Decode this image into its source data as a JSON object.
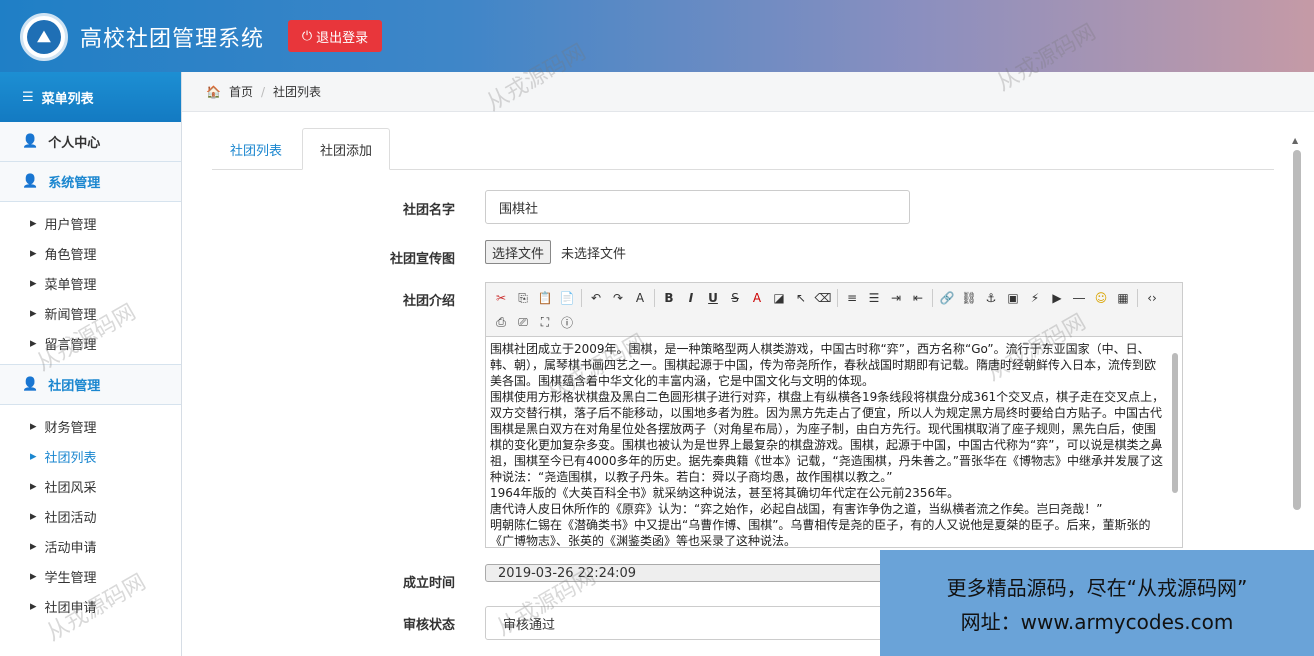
{
  "header": {
    "title": "高校社团管理系统",
    "logout_label": "退出登录"
  },
  "sidebar": {
    "menu_title": "菜单列表",
    "personal": "个人中心",
    "system": {
      "label": "系统管理",
      "items": [
        "用户管理",
        "角色管理",
        "菜单管理",
        "新闻管理",
        "留言管理"
      ]
    },
    "club": {
      "label": "社团管理",
      "items": [
        "财务管理",
        "社团列表",
        "社团风采",
        "社团活动",
        "活动申请",
        "学生管理",
        "社团申请"
      ]
    },
    "active_item": "社团列表"
  },
  "breadcrumb": {
    "home": "首页",
    "current": "社团列表"
  },
  "tabs": [
    {
      "label": "社团列表"
    },
    {
      "label": "社团添加"
    }
  ],
  "form": {
    "name_label": "社团名字",
    "name_value": "围棋社",
    "image_label": "社团宣传图",
    "file_button": "选择文件",
    "file_status": "未选择文件",
    "intro_label": "社团介绍",
    "intro_paragraphs": [
      "围棋社团成立于2009年。围棋，是一种策略型两人棋类游戏，中国古时称“弈”，西方名称“Go”。流行于东亚国家（中、日、韩、朝），属琴棋书画四艺之一。围棋起源于中国，传为帝尧所作，春秋战国时期即有记载。隋唐时经朝鲜传入日本，流传到欧美各国。围棋蕴含着中华文化的丰富内涵，它是中国文化与文明的体现。",
      "围棋使用方形格状棋盘及黑白二色圆形棋子进行对弈，棋盘上有纵横各19条线段将棋盘分成361个交叉点，棋子走在交叉点上，双方交替行棋，落子后不能移动，以围地多者为胜。因为黑方先走占了便宜，所以人为规定黑方局终时要给白方贴子。中国古代围棋是黑白双方在对角星位处各摆放两子（对角星布局），为座子制，由白方先行。现代围棋取消了座子规则，黑先白后，使围棋的变化更加复杂多变。围棋也被认为是世界上最复杂的棋盘游戏。围棋，起源于中国，中国古代称为“弈”，可以说是棋类之鼻祖，围棋至今已有4000多年的历史。据先秦典籍《世本》记载，“尧造围棋，丹朱善之。”晋张华在《博物志》中继承并发展了这种说法：“尧造围棋，以教子丹朱。若白：舜以子商均愚，故作围棋以教之。”",
      "1964年版的《大英百科全书》就采纳这种说法，甚至将其确切年代定在公元前2356年。",
      "唐代诗人皮日休所作的《原弈》认为：“弈之始作，必起自战国，有害诈争伪之道，当纵横者流之作矣。岂曰尧哉！”",
      "明朝陈仁锡在《潜确类书》中又提出“乌曹作博、围棋”。乌曹相传是尧的臣子，有的人又说他是夏桀的臣子。后来，董斯张的《广博物志》、张英的《渊鉴类函》等也采录了这种说法。"
    ],
    "date_label": "成立时间",
    "date_value": "2019-03-26 22:24:09",
    "status_label": "审核状态",
    "status_value": "审核通过"
  },
  "toolbar_row1": [
    "cut-icon",
    "copy-icon",
    "paste-icon",
    "paste-text-icon",
    "sep",
    "undo-icon",
    "redo-icon",
    "font-icon",
    "sep",
    "bold-icon",
    "italic-icon",
    "underline-icon",
    "strike-icon",
    "font-color-icon",
    "bg-color-icon",
    "select-icon",
    "eraser-icon",
    "sep",
    "align-left-icon",
    "list-icon",
    "indent-icon",
    "outdent-icon",
    "sep",
    "link-icon",
    "unlink-icon",
    "anchor-icon",
    "image-icon",
    "flash-icon",
    "media-icon",
    "hr-icon",
    "emoji-icon",
    "table-icon",
    "sep",
    "source-icon"
  ],
  "toolbar_row2": [
    "preview-icon",
    "print-icon",
    "fullscreen-icon",
    "about-icon"
  ],
  "promo": {
    "line1": "更多精品源码，尽在“从戎源码网”",
    "line2": "网址：www.armycodes.com"
  },
  "watermark": "从戎源码网"
}
